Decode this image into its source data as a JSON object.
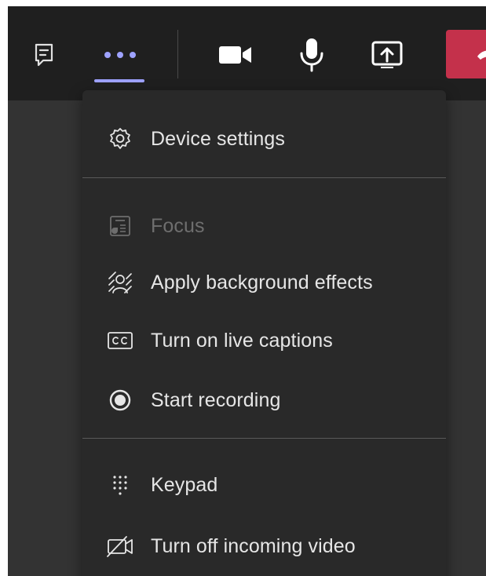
{
  "toolbar": {
    "icons": [
      "chat-icon",
      "more-options-icon",
      "camera-icon",
      "microphone-icon",
      "share-screen-icon",
      "hang-up-icon"
    ]
  },
  "colors": {
    "toolbar_bg": "#1f1f1f",
    "menu_bg": "#292929",
    "accent": "#9ea2ff",
    "leave": "#c4314b",
    "text": "#e6e6e6",
    "disabled_text": "#6e6e6e"
  },
  "menu": {
    "device_settings": "Device settings",
    "focus": "Focus",
    "background_effects": "Apply background effects",
    "live_captions": "Turn on live captions",
    "start_recording": "Start recording",
    "keypad": "Keypad",
    "incoming_video": "Turn off incoming video"
  }
}
